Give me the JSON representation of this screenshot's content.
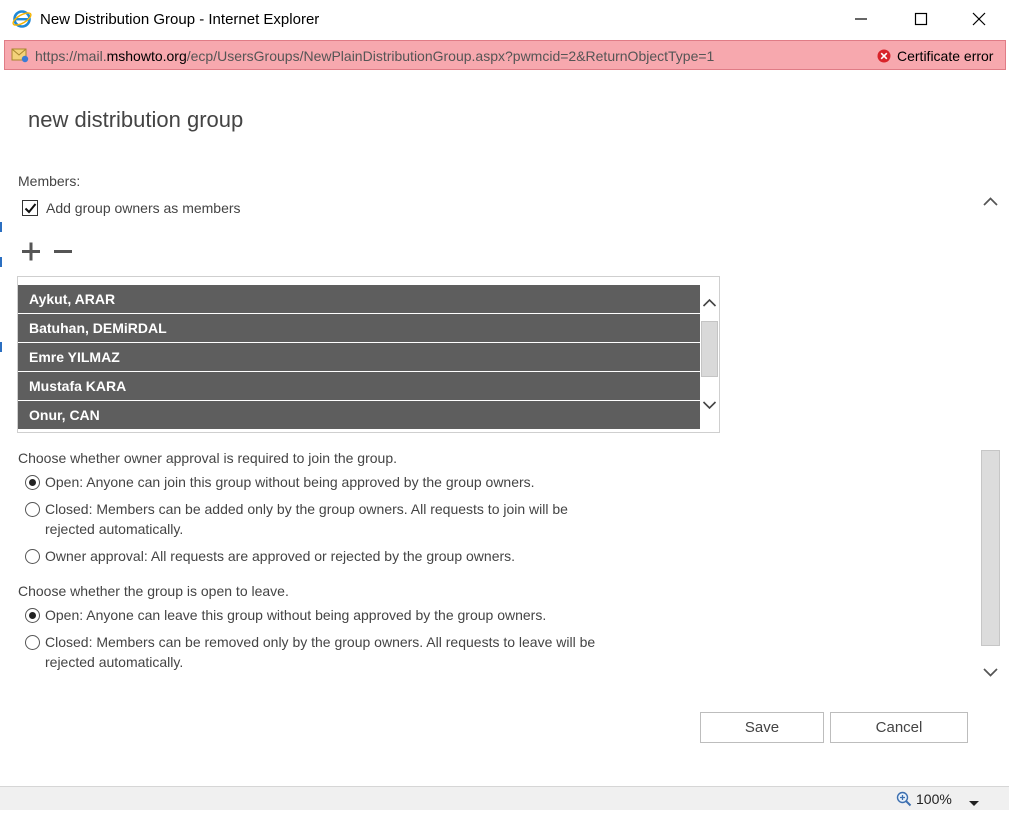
{
  "window": {
    "title": "New Distribution Group - Internet Explorer"
  },
  "address": {
    "url_prefix": "https://mail.",
    "url_domain": "mshowto.org",
    "url_path": "/ecp/UsersGroups/NewPlainDistributionGroup.aspx?pwmcid=2&ReturnObjectType=1",
    "cert_error": "Certificate error"
  },
  "page": {
    "title": "new distribution group"
  },
  "members": {
    "label": "Members:",
    "add_owners_label": "Add group owners as members",
    "add_owners_checked": true,
    "list": [
      "Aykut, ARAR",
      "Batuhan, DEMiRDAL",
      "Emre YILMAZ",
      "Mustafa KARA",
      "Onur, CAN"
    ]
  },
  "join": {
    "label": "Choose whether owner approval is required to join the group.",
    "options": [
      {
        "line1": "Open: Anyone can join this group without being approved by the group owners.",
        "line2": "",
        "selected": true
      },
      {
        "line1": "Closed: Members can be added only by the group owners. All requests to join will be",
        "line2": "rejected automatically.",
        "selected": false
      },
      {
        "line1": "Owner approval: All requests are approved or rejected by the group owners.",
        "line2": "",
        "selected": false
      }
    ]
  },
  "leave": {
    "label": "Choose whether the group is open to leave.",
    "options": [
      {
        "line1": "Open: Anyone can leave this group without being approved by the group owners.",
        "line2": "",
        "selected": true
      },
      {
        "line1": "Closed: Members can be removed only by the group owners. All requests to leave will be",
        "line2": "rejected automatically.",
        "selected": false
      }
    ]
  },
  "buttons": {
    "save": "Save",
    "cancel": "Cancel"
  },
  "status": {
    "zoom": "100%"
  },
  "colors": {
    "member_row_bg": "#5e5e5e",
    "address_error_bg": "#f7a8ae"
  }
}
